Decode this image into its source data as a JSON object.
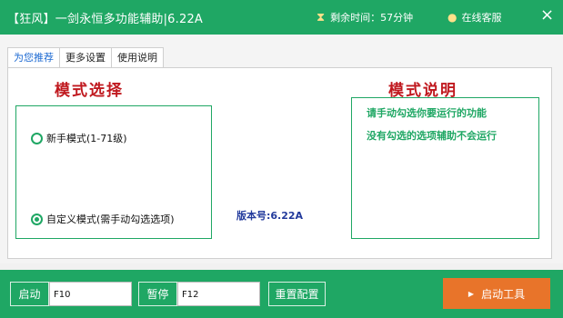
{
  "window": {
    "title": "【狂风】一剑永恒多功能辅助|6.22A",
    "timer_text": "剩余时间：57分钟",
    "service_label": "在线客服",
    "close_glyph": "×"
  },
  "tabs": [
    {
      "label": "为您推荐",
      "active": true
    },
    {
      "label": "更多设置",
      "active": false
    },
    {
      "label": "使用说明",
      "active": false
    }
  ],
  "mode_select": {
    "title": "模式选择",
    "options": [
      {
        "label": "新手模式(1-71级)",
        "selected": false
      },
      {
        "label": "自定义模式(需手动勾选选项)",
        "selected": true
      }
    ]
  },
  "version_text": "版本号:6.22A",
  "mode_desc": {
    "title": "模式说明",
    "lines": [
      "请手动勾选你要运行的功能",
      "没有勾选的选项辅助不会运行"
    ]
  },
  "bottom": {
    "start_label": "启动",
    "start_key": "F10",
    "pause_label": "暂停",
    "pause_key": "F12",
    "reset_label": "重置配置",
    "launch_label": "启动工具"
  },
  "colors": {
    "accent": "#1fa764",
    "title_red": "#c0191f",
    "launch_orange": "#e8742a"
  },
  "icons": {
    "timer": "hourglass-icon",
    "service": "chat-icon",
    "launch": "play-arrow-icon"
  }
}
